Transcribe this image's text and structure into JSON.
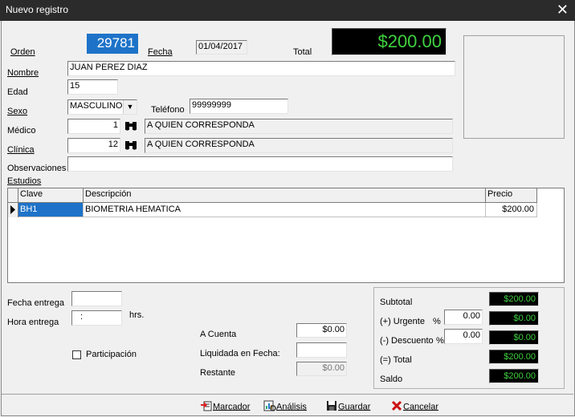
{
  "window": {
    "title": "Nuevo registro",
    "close_glyph": "✕"
  },
  "header": {
    "orden_label": "Orden",
    "orden_value": "29781",
    "fecha_label": "Fecha",
    "fecha_value": "01/04/2017",
    "total_label": "Total",
    "total_value": "$200.00"
  },
  "form": {
    "nombre_label": "Nombre",
    "nombre_value": "JUAN PEREZ DIAZ",
    "edad_label": "Edad",
    "edad_value": "15",
    "sexo_label": "Sexo",
    "sexo_value": "MASCULINO",
    "telefono_label": "Teléfono",
    "telefono_value": "99999999",
    "medico_label": "Médico",
    "medico_id": "1",
    "medico_name": "A QUIEN CORRESPONDA",
    "clinica_label": "Clínica",
    "clinica_id": "12",
    "clinica_name": "A QUIEN CORRESPONDA",
    "observaciones_label": "Observaciones",
    "observaciones_value": ""
  },
  "estudios": {
    "label": "Estudios",
    "columns": [
      "Clave",
      "Descripción",
      "Precio"
    ],
    "rows": [
      {
        "clave": "BH1",
        "descripcion": "BIOMETRIA HEMATICA",
        "precio": "$200.00"
      }
    ]
  },
  "entrega": {
    "fecha_label": "Fecha entrega",
    "fecha_value": "",
    "hora_label": "Hora entrega",
    "hora_value": ":",
    "hrs_label": "hrs.",
    "participacion_label": "Participación"
  },
  "pagos": {
    "a_cuenta_label": "A Cuenta",
    "a_cuenta_value": "$0.00",
    "liquidada_label": "Liquidada en Fecha:",
    "liquidada_value": "",
    "restante_label": "Restante",
    "restante_value": "$0.00"
  },
  "totales": {
    "subtotal_label": "Subtotal",
    "subtotal_value": "$200.00",
    "urgente_label": "(+) Urgente",
    "urgente_pct_sign": "%",
    "urgente_pct": "0.00",
    "urgente_value": "$0.00",
    "descuento_label": "(-) Descuento",
    "descuento_pct_sign": "%",
    "descuento_pct": "0.00",
    "descuento_value": "$0.00",
    "total_label": "(=) Total",
    "total_value": "$200.00",
    "saldo_label": "Saldo",
    "saldo_value": "$200.00"
  },
  "toolbar": {
    "marcador_label": "Marcador",
    "analisis_label": "Análisis",
    "guardar_label": "Guardar",
    "cancelar_label": "Cancelar"
  },
  "colors": {
    "accent": "#1e73c8",
    "display_bg": "#000000",
    "display_fg": "#3fd13f",
    "cancel_red": "#cc1111"
  }
}
